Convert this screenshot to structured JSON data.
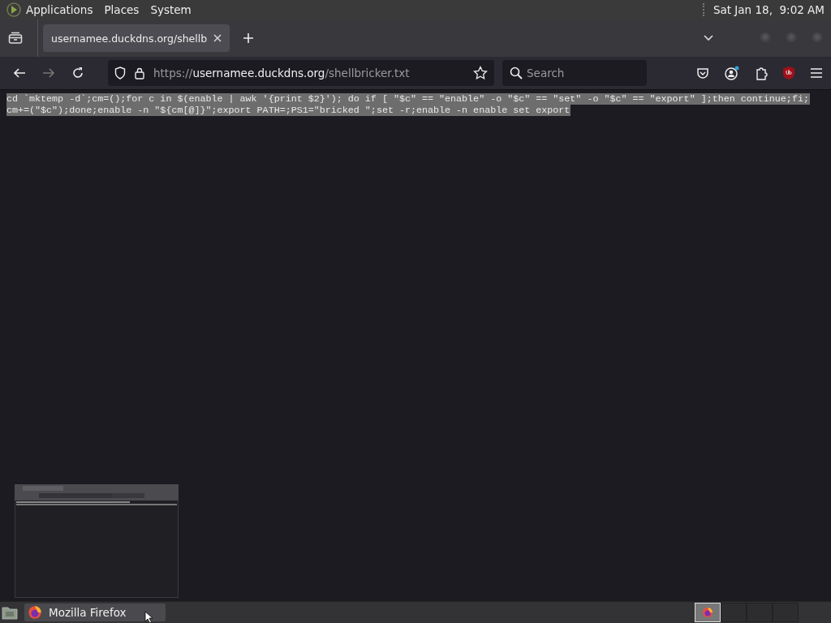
{
  "top_panel": {
    "menus": [
      "Applications",
      "Places",
      "System"
    ],
    "clock": "Sat Jan 18,  9:02 AM"
  },
  "tabs": [
    {
      "title": "usernamee.duckdns.org/shellb",
      "selected": true
    }
  ],
  "toolbar": {
    "url_prefix": "https://",
    "url_host": "usernamee.duckdns.org",
    "url_path": "/shellbricker.txt",
    "search_placeholder": "Search"
  },
  "content": {
    "lines": [
      "cd `mktemp -d`;cm=();for c in $(enable | awk '{print $2}'); do if [ \"$c\" == \"enable\" -o \"$c\" == \"set\" -o \"$c\" == \"export\" ];then continue;fi;",
      "cm+=(\"$c\");done;enable -n \"${cm[@]}\";export PATH=;PS1=\"bricked \";set -r;enable -n enable set export"
    ],
    "selected": true
  },
  "taskbar": {
    "tasks": [
      {
        "title": "Mozilla Firefox",
        "selected": true
      }
    ]
  }
}
